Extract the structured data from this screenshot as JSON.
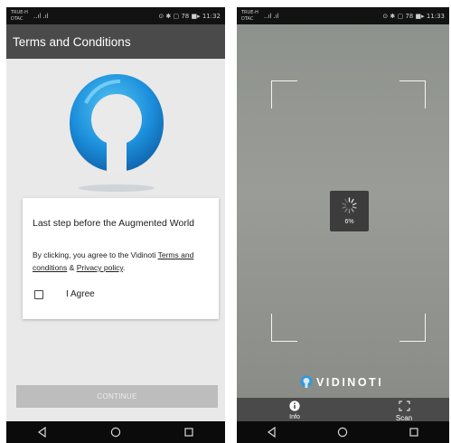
{
  "left_screen": {
    "status_bar": {
      "carrier": "TRUE-H\nDTAC",
      "signal": "..ıl .ıl",
      "right_icons": "⊙ ✱ ▢ 78 ■▸ 11:32"
    },
    "app_bar": {
      "title": "Terms and Conditions"
    },
    "card": {
      "heading": "Last step before the Augmented World",
      "description_prefix": "By clicking, you agree to the Vidinoti ",
      "terms_link": "Terms and conditions",
      "amp": " & ",
      "privacy_link": "Privacy policy",
      "period": ".",
      "agree_label": "I Agree",
      "agree_checked": false
    },
    "continue_button": {
      "label": "CONTINUE"
    },
    "colors": {
      "logo_blue": "#1a8ad8",
      "logo_light": "#4fc0f0",
      "appbar": "#4a4a4a"
    }
  },
  "right_screen": {
    "status_bar": {
      "carrier": "TRUE-H\nDTAC",
      "signal": "..ıl .ıl",
      "right_icons": "⊙ ✱ ▢ 78 ■▸ 11:33"
    },
    "progress": {
      "label": "6%",
      "value": 6
    },
    "brand": {
      "name": "VIDINOTI",
      "icon": "vidinoti-logo-icon"
    },
    "bottom_tabs": [
      {
        "label": "Info",
        "icon": "info-icon"
      },
      {
        "label": "Scan",
        "icon": "scan-frame-icon"
      }
    ]
  }
}
